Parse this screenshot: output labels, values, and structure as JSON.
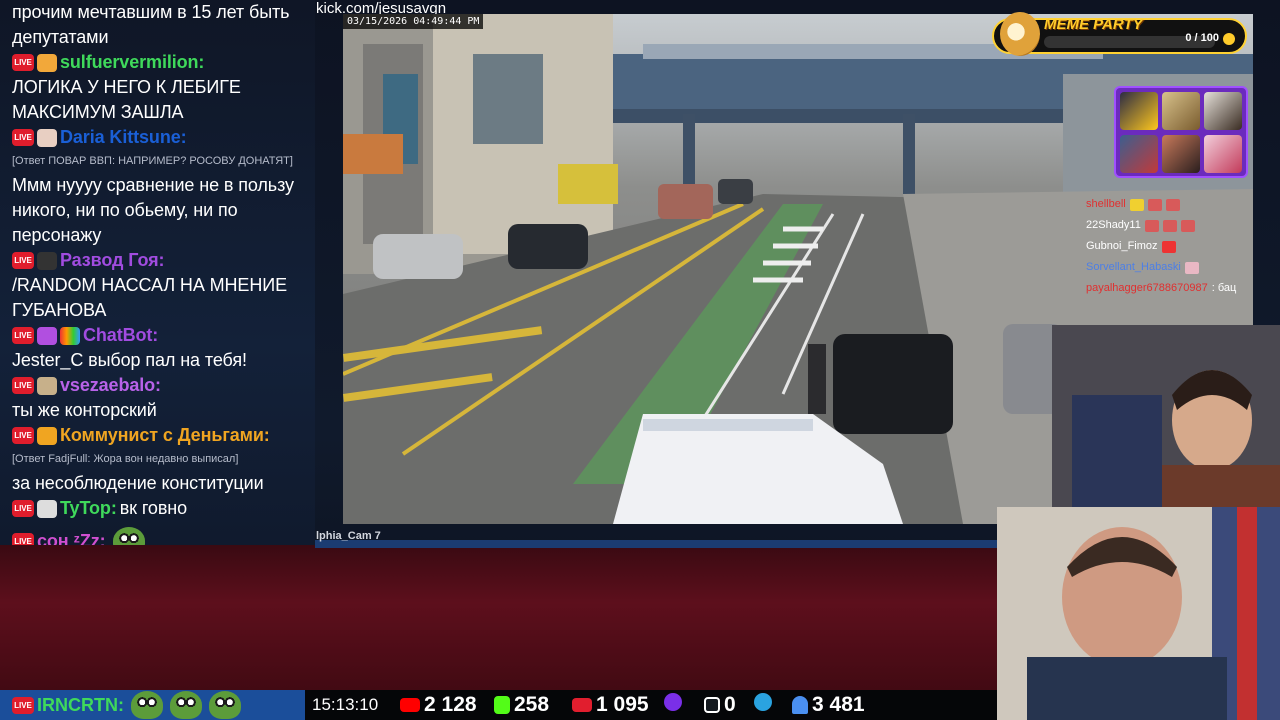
{
  "stream_url": "kick.com/jesusavgn",
  "camera_timestamp": "03/15/2026 04:49:44 PM",
  "camera_label": "lphia_Cam 7",
  "meme_party": {
    "title": "MEME PARTY",
    "count": "0 / 100",
    "progress_fraction": 0.0
  },
  "chat": {
    "messages": [
      {
        "type": "continuation",
        "text": "прочим мечтавшим в 15 лет быть депутатами"
      },
      {
        "type": "message",
        "nick": "sulfuervermilion:",
        "nick_color": "#3fd95b",
        "text": "ЛОГИКА У НЕГО К ЛЕБИГЕ МАКСИМУМ ЗАШЛА"
      },
      {
        "type": "message",
        "nick": "Daria Kittsune:",
        "nick_color": "#1a5fd6",
        "text": ""
      },
      {
        "type": "reply",
        "text": "[Ответ ПОВАР ВВП: НАПРИМЕР? РОСОВУ ДОНАТЯТ]"
      },
      {
        "type": "continuation",
        "text": "Ммм нуууу сравнение не в пользу никого, ни по обьему, ни по персонажу"
      },
      {
        "type": "message",
        "nick": "Развод Гоя:",
        "nick_color": "#a14ce0",
        "text": "/RANDOM НАССАЛ НА МНЕНИЕ ГУБАНОВА"
      },
      {
        "type": "message",
        "nick": "ChatBot:",
        "nick_color": "#a14ce0",
        "text": "Jester_C выбор пал на тебя!"
      },
      {
        "type": "message",
        "nick": "vsezaebalo:",
        "nick_color": "#b862e8",
        "text": "ты же конторский"
      },
      {
        "type": "message",
        "nick": "Коммунист с Деньгами:",
        "nick_color": "#f0a521",
        "text": ""
      },
      {
        "type": "reply",
        "text": "[Ответ FadjFull: Жора вон недавно выписал]"
      },
      {
        "type": "continuation",
        "text": "за несоблюдение конституции"
      },
      {
        "type": "message",
        "nick": "TyTop:",
        "nick_color": "#3fd95b",
        "text": "вк говно"
      },
      {
        "type": "message",
        "nick": "сон ᶻZz:",
        "nick_color": "#d04fd0",
        "text": ""
      },
      {
        "type": "message",
        "nick": "IRNCRTN:",
        "nick_color": "#3fd95b",
        "text": ""
      }
    ],
    "live_badge": "LIVE"
  },
  "mini_chat": [
    {
      "nick": "shellbell",
      "color": "#e03030",
      "text": ""
    },
    {
      "nick": "22Shady11",
      "color": "#ffffff",
      "text": ""
    },
    {
      "nick": "Gubnoi_Fimoz",
      "color": "#ffffff",
      "text": ""
    },
    {
      "nick": "Sorvellant_Habaski",
      "color": "#4d7fe6",
      "text": ""
    },
    {
      "nick": "payalhagger6788670987",
      "color": "#e03030",
      "text": ": бац"
    }
  ],
  "bottom_bar": {
    "clock": "15:13:10",
    "youtube": "2 128",
    "kick": "258",
    "vk_live": "1 095",
    "rutube": "0",
    "viewers": "3 481",
    "colors": {
      "youtube": "#ff0000",
      "kick": "#53fc18",
      "vk_live": "#e11e2e",
      "rutube": "#14191f",
      "telegram": "#2aa3e0",
      "viewers": "#4a8ff0"
    }
  }
}
